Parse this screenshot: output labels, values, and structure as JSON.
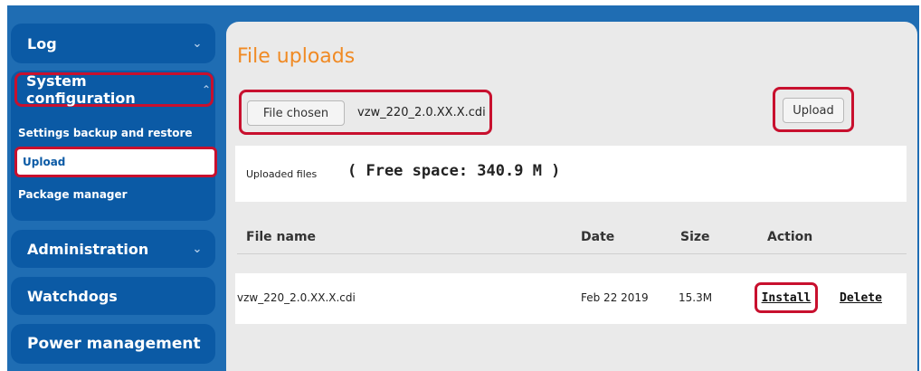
{
  "sidebar": {
    "log_label": "Log",
    "system_configuration": {
      "label": "System configuration",
      "items": [
        "Settings backup and restore",
        "Upload",
        "Package manager"
      ]
    },
    "administration_label": "Administration",
    "watchdogs_label": "Watchdogs",
    "power_management_label": "Power management"
  },
  "main": {
    "title": "File uploads",
    "file_chosen_button": "File chosen",
    "file_chosen_name": "vzw_220_2.0.XX.X.cdi",
    "upload_button": "Upload",
    "uploaded_files_label": "Uploaded files",
    "free_space": "( Free space: 340.9 M )",
    "table": {
      "headers": {
        "name": "File name",
        "date": "Date",
        "size": "Size",
        "action": "Action"
      },
      "rows": [
        {
          "name": "vzw_220_2.0.XX.X.cdi",
          "date": "Feb 22 2019",
          "size": "15.3M",
          "install": "Install",
          "delete": "Delete"
        }
      ]
    }
  },
  "colors": {
    "frame_blue": "#1f6db3",
    "nav_blue": "#0b5aa5",
    "title_orange": "#f08a24",
    "highlight_red": "#c8102e"
  },
  "icons": {
    "chevron_down": "chevron-down-icon",
    "chevron_up": "chevron-up-icon"
  }
}
